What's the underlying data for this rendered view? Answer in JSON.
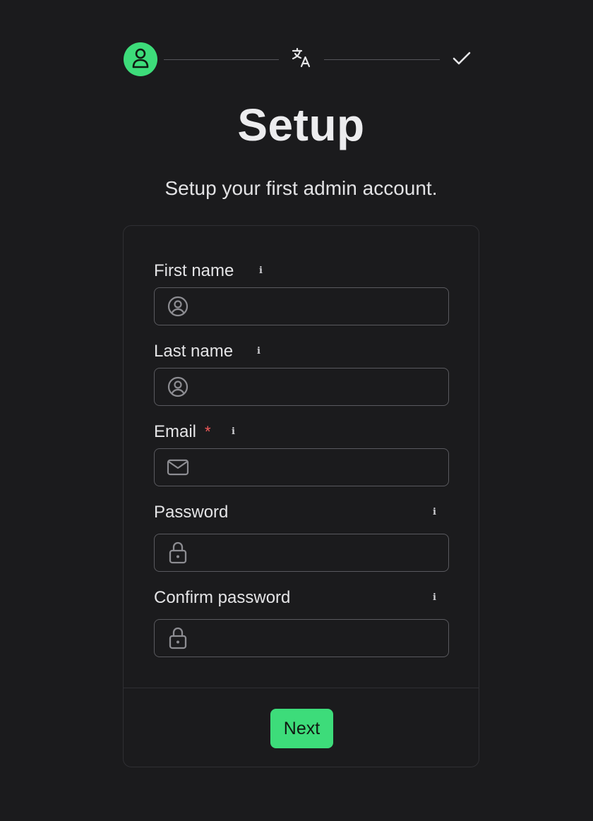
{
  "stepper": {
    "steps": [
      {
        "icon": "user-icon",
        "state": "active"
      },
      {
        "icon": "translate-icon",
        "state": "pending"
      },
      {
        "icon": "checkmark-icon",
        "state": "pending"
      }
    ],
    "active_color": "#3ddc7a"
  },
  "header": {
    "title": "Setup",
    "subtitle": "Setup your first admin account."
  },
  "form": {
    "fields": [
      {
        "label": "First name",
        "icon": "user-circle-icon",
        "value": "",
        "required": false
      },
      {
        "label": "Last name",
        "icon": "user-circle-icon",
        "value": "",
        "required": false
      },
      {
        "label": "Email",
        "icon": "mail-icon",
        "value": "",
        "required": true,
        "required_mark": "*"
      },
      {
        "label": "Password",
        "icon": "lock-icon",
        "value": "",
        "required": false
      },
      {
        "label": "Confirm password",
        "icon": "lock-icon",
        "value": "",
        "required": false
      }
    ],
    "info_glyph": "i",
    "next_label": "Next"
  },
  "colors": {
    "background": "#1b1b1d",
    "accent": "#3ddc7a",
    "required": "#f05a5a"
  }
}
